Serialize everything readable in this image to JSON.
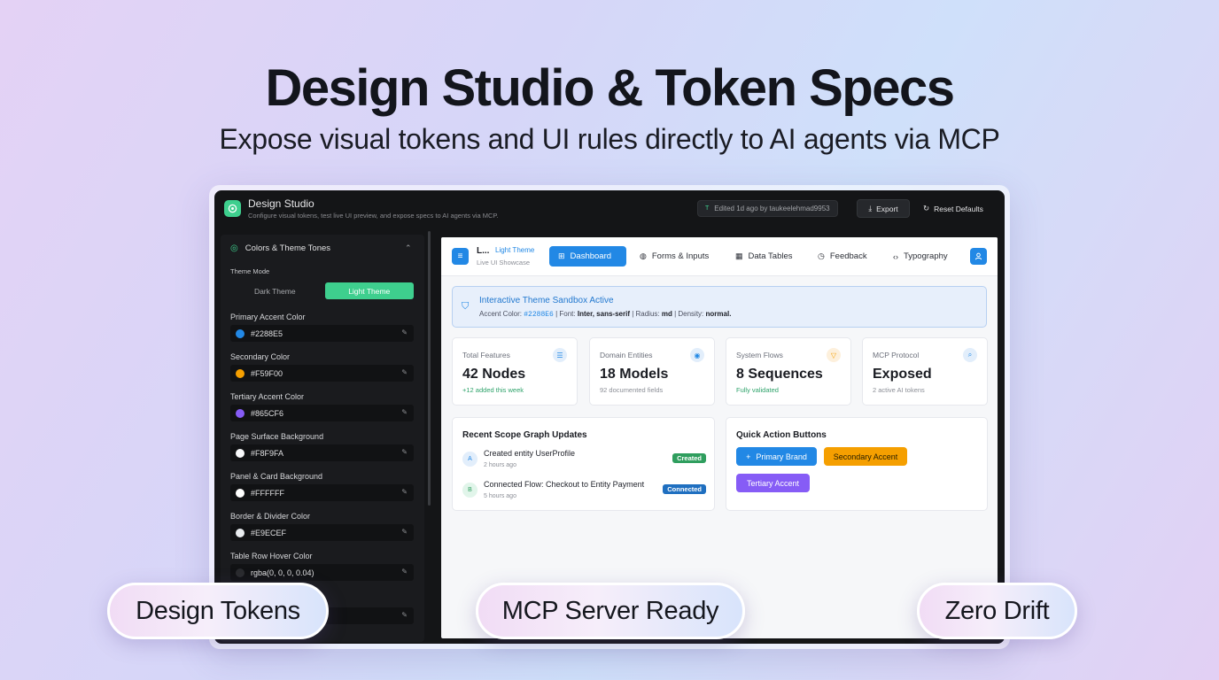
{
  "hero": {
    "title": "Design Studio & Token Specs",
    "subtitle": "Expose visual tokens and UI rules directly to AI agents via MCP"
  },
  "app": {
    "title": "Design Studio",
    "description": "Configure visual tokens, test live UI preview, and expose specs to AI agents via MCP.",
    "edited_tag": "T",
    "edited_text": "Edited 1d ago by taukeelehmad9953",
    "export_label": "Export",
    "reset_label": "Reset Defaults"
  },
  "sidebar": {
    "section_title": "Colors & Theme Tones",
    "theme_mode_label": "Theme Mode",
    "theme_options": [
      "Dark Theme",
      "Light Theme"
    ],
    "selected_theme": "Light Theme",
    "fields": [
      {
        "label": "Primary Accent Color",
        "value": "#2288E5",
        "swatch": "#2288e5"
      },
      {
        "label": "Secondary Color",
        "value": "#F59F00",
        "swatch": "#f59f00"
      },
      {
        "label": "Tertiary Accent Color",
        "value": "#865CF6",
        "swatch": "#865cf6"
      },
      {
        "label": "Page Surface Background",
        "value": "#F8F9FA",
        "swatch": "#f8f9fa"
      },
      {
        "label": "Panel & Card Background",
        "value": "#FFFFFF",
        "swatch": "#ffffff"
      },
      {
        "label": "Border & Divider Color",
        "value": "#E9ECEF",
        "swatch": "#e9ecef"
      },
      {
        "label": "Table Row Hover Color",
        "value": "rgba(0, 0, 0, 0.04)",
        "swatch": "#2a2b2e"
      }
    ]
  },
  "preview": {
    "brand_title": "L...",
    "brand_badge": "Light Theme",
    "brand_sub": "Live UI Showcase",
    "tabs": [
      {
        "label": "Dashboard",
        "icon": "grid-icon"
      },
      {
        "label": "Forms & Inputs",
        "icon": "palette-icon"
      },
      {
        "label": "Data Tables",
        "icon": "table-icon"
      },
      {
        "label": "Feedback",
        "icon": "clock-icon"
      },
      {
        "label": "Typography",
        "icon": "code-icon"
      }
    ],
    "banner": {
      "title": "Interactive Theme Sandbox Active",
      "accent_label": "Accent Color: ",
      "accent_value": "#2288E6",
      "font_label": " | Font: ",
      "font_value": "Inter, sans-serif",
      "radius_label": " | Radius: ",
      "radius_value": "md",
      "density_label": " | Density: ",
      "density_value": "normal."
    },
    "stats": [
      {
        "label": "Total Features",
        "value": "42 Nodes",
        "note": "+12 added this week",
        "icon": "list-icon",
        "color": "#2288e5"
      },
      {
        "label": "Domain Entities",
        "value": "18 Models",
        "note": "92 documented fields",
        "icon": "database-icon",
        "color": "#2288e5"
      },
      {
        "label": "System Flows",
        "value": "8 Sequences",
        "note": "Fully validated",
        "icon": "filter-icon",
        "color": "#f59f00"
      },
      {
        "label": "MCP Protocol",
        "value": "Exposed",
        "note": "2 active AI tokens",
        "icon": "search-icon",
        "color": "#2288e5"
      }
    ],
    "recent": {
      "title": "Recent Scope Graph Updates",
      "items": [
        {
          "avatar": "A",
          "text": "Created entity UserProfile",
          "time": "2 hours ago",
          "badge": "Created",
          "badge_color": "#2f9e5e"
        },
        {
          "avatar": "B",
          "text": "Connected Flow: Checkout to Entity Payment",
          "time": "5 hours ago",
          "badge": "Connected",
          "badge_color": "#1f6fc0"
        }
      ]
    },
    "quick": {
      "title": "Quick Action Buttons",
      "primary": "Primary Brand",
      "secondary": "Secondary Accent",
      "tertiary": "Tertiary Accent"
    }
  },
  "pills": [
    "Design Tokens",
    "MCP Server Ready",
    "Zero Drift"
  ]
}
